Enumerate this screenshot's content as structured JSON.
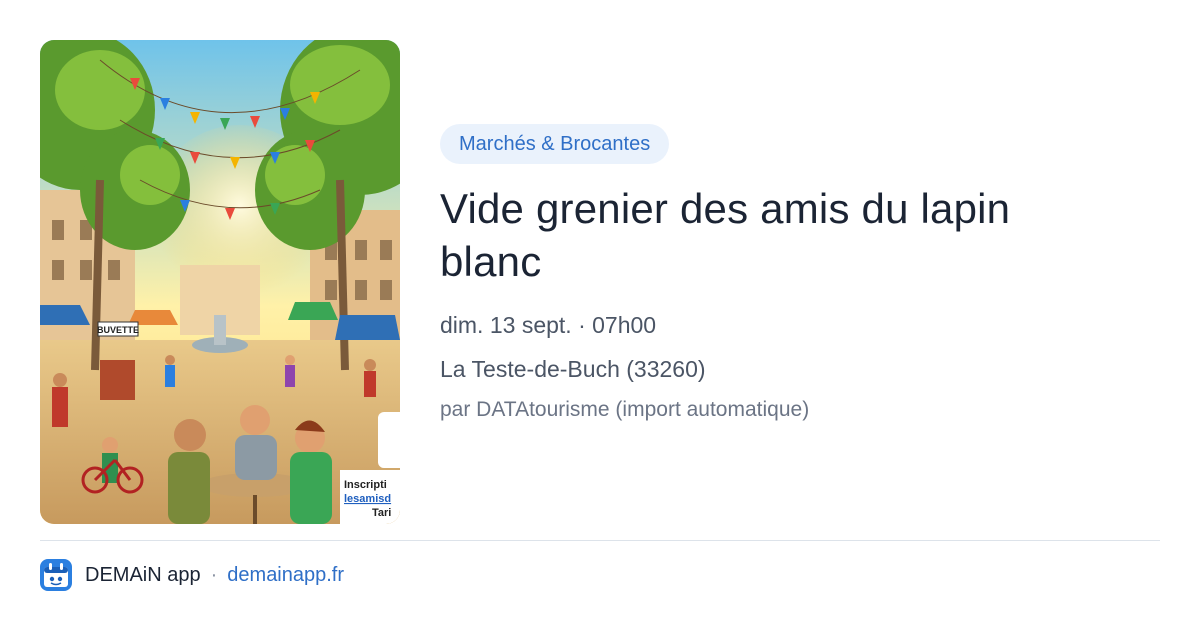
{
  "event": {
    "image": {
      "alt_icon": "market-illustration",
      "stall_sign": "BUVETTE",
      "overlay_lines": [
        "Inscripti",
        "lesamisd",
        "Tari"
      ]
    },
    "category": "Marchés & Brocantes",
    "title": "Vide grenier des amis du lapin blanc",
    "datetime": "dim. 13 sept. · 07h00",
    "location": "La Teste-de-Buch (33260)",
    "organizer": "par DATAtourisme (import automatique)"
  },
  "footer": {
    "app_icon": "demain-app-icon",
    "app_name": "DEMAiN app",
    "separator": "·",
    "domain": "demainapp.fr"
  },
  "colors": {
    "badge_bg": "#eaf2fc",
    "badge_text": "#2f6fc7",
    "title": "#1b2434",
    "meta": "#4b5565",
    "link": "#2f6fc7",
    "app_icon_bg": "#2b7fe0"
  }
}
